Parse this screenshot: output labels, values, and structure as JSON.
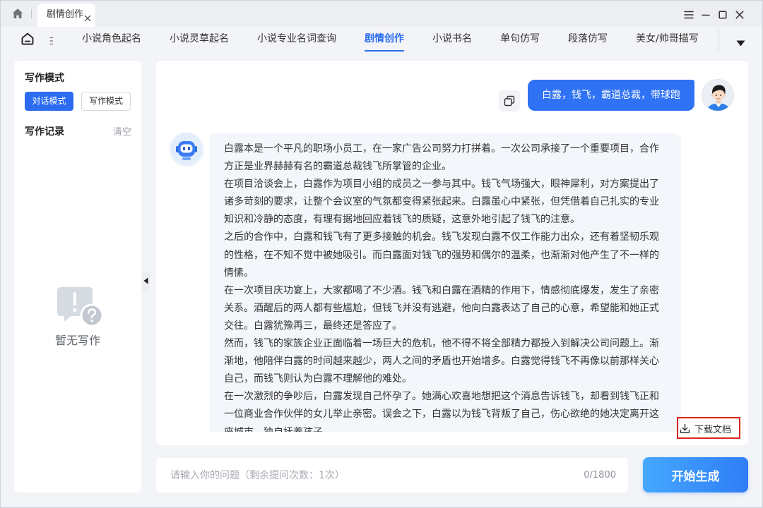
{
  "titlebar": {
    "home_icon": "home-icon",
    "tab": {
      "label": "剧情创作",
      "close_icon": "close-icon"
    },
    "window_controls": [
      "menu-icon",
      "minimize-icon",
      "maximize-icon",
      "close-icon"
    ]
  },
  "nav": {
    "home_icon": "home-outline-icon",
    "toggle_icon": "sidebar-toggle-icon",
    "items": [
      {
        "label": "小说角色起名"
      },
      {
        "label": "小说灵草起名"
      },
      {
        "label": "小说专业名词查询"
      },
      {
        "label": "剧情创作"
      },
      {
        "label": "小说书名"
      },
      {
        "label": "单句仿写"
      },
      {
        "label": "段落仿写"
      },
      {
        "label": "美女/帅哥描写"
      }
    ],
    "active_index": 3,
    "more_icon": "caret-down-icon"
  },
  "sidebar": {
    "mode_heading": "写作模式",
    "modes": [
      {
        "label": "对话模式",
        "active": true
      },
      {
        "label": "写作模式",
        "active": false
      }
    ],
    "records_heading": "写作记录",
    "clear_label": "清空",
    "empty_icon": "empty-message-icon",
    "empty_text": "暂无写作",
    "collapse_icon": "caret-left-icon"
  },
  "chat": {
    "copy_icon": "copy-icon",
    "user_message": "白露，钱飞，霸道总裁，带球跑",
    "user_avatar": "user-avatar",
    "bot_avatar": "robot-avatar",
    "bot_paragraphs": [
      "白露本是一个平凡的职场小员工，在一家广告公司努力打拼着。一次公司承接了一个重要项目，合作方正是业界赫赫有名的霸道总裁钱飞所掌管的企业。",
      "在项目洽谈会上，白露作为项目小组的成员之一参与其中。钱飞气场强大，眼神犀利，对方案提出了诸多苛刻的要求，让整个会议室的气氛都变得紧张起来。白露虽心中紧张，但凭借着自己扎实的专业知识和冷静的态度，有理有据地回应着钱飞的质疑，这意外地引起了钱飞的注意。",
      "之后的合作中，白露和钱飞有了更多接触的机会。钱飞发现白露不仅工作能力出众，还有着坚韧乐观的性格，在不知不觉中被她吸引。而白露面对钱飞的强势和偶尔的温柔，也渐渐对他产生了不一样的情愫。",
      "在一次项目庆功宴上，大家都喝了不少酒。钱飞和白露在酒精的作用下，情感彻底爆发，发生了亲密关系。酒醒后的两人都有些尴尬，但钱飞并没有逃避，他向白露表达了自己的心意，希望能和她正式交往。白露犹豫再三，最终还是答应了。",
      "然而，钱飞的家族企业正面临着一场巨大的危机，他不得不将全部精力都投入到解决公司问题上。渐渐地，他陪伴白露的时间越来越少，两人之间的矛盾也开始增多。白露觉得钱飞不再像以前那样关心自己，而钱飞则认为白露不理解他的难处。",
      "在一次激烈的争吵后，白露发现自己怀孕了。她满心欢喜地想把这个消息告诉钱飞，却看到钱飞正和一位商业合作伙伴的女儿举止亲密。误会之下，白露以为钱飞背叛了自己，伤心欲绝的她决定离开这座城市，独自抚养孩子。"
    ],
    "download": {
      "icon": "download-icon",
      "label": "下载文档"
    }
  },
  "composer": {
    "placeholder": "请输入你的问题（剩余提问次数：1次）",
    "value": "",
    "counter": "0/1800",
    "submit_label": "开始生成"
  },
  "colors": {
    "accent": "#2b6cf0",
    "user_bubble": "#2f72f4",
    "bot_bubble": "#f3f6fa",
    "page_background": "#f3f4f7",
    "highlight_box": "#d9261c",
    "submit_gradient": [
      "#45a8ff",
      "#2e7df5"
    ]
  }
}
